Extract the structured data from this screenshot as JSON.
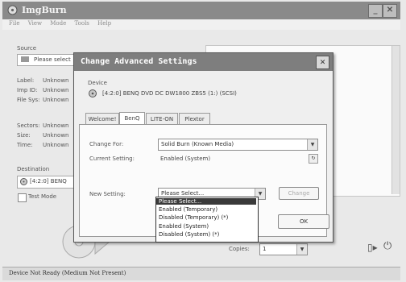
{
  "main_window": {
    "title": "ImgBurn",
    "menu": [
      "File",
      "View",
      "Mode",
      "Tools",
      "Help"
    ],
    "source_label": "Source",
    "source_value": "Please select",
    "info": {
      "label_k": "Label:",
      "label_v": "Unknown",
      "imp_k": "Imp ID:",
      "imp_v": "Unknown",
      "fs_k": "File Sys:",
      "fs_v": "Unknown",
      "sectors_k": "Sectors:",
      "sectors_v": "Unknown",
      "size_k": "Size:",
      "size_v": "Unknown",
      "time_k": "Time:",
      "time_v": "Unknown"
    },
    "destination_label": "Destination",
    "destination_value": "[4:2:0] BENQ",
    "test_mode": "Test Mode",
    "copies_label": "Copies:",
    "copies_value": "1",
    "status_text": "Device Not Ready (Medium Not Present)"
  },
  "dialog": {
    "title": "Change Advanced Settings",
    "device_label": "Device",
    "device_value": "[4:2:0] BENQ DVD DC DW1800 ZBS5 (1:) (SCSI)",
    "tabs": [
      "Welcome!",
      "BenQ",
      "LITE-ON",
      "Plextor"
    ],
    "change_for_label": "Change For:",
    "change_for_value": "Solid Burn (Known Media)",
    "current_setting_label": "Current Setting:",
    "current_setting_value": "Enabled (System)",
    "new_setting_label": "New Setting:",
    "new_setting_value": "Please Select...",
    "change_button": "Change",
    "ok_button": "OK",
    "options": [
      "Please Select...",
      "Enabled (Temporary)",
      "Disabled (Temporary) (*)",
      "Enabled (System)",
      "Disabled (System) (*)"
    ]
  }
}
